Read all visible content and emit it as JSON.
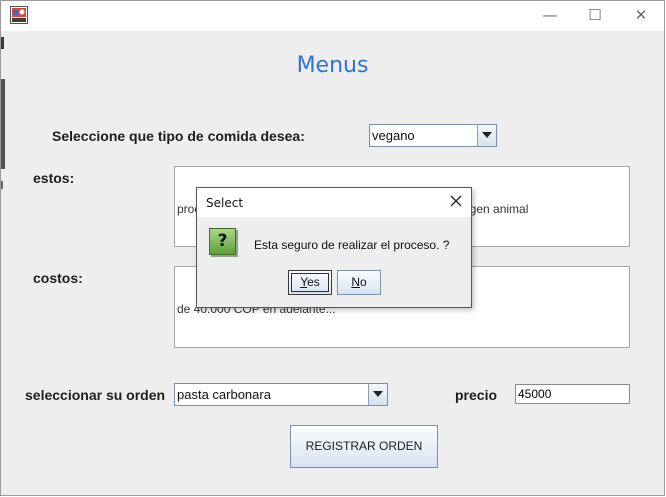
{
  "window": {
    "title": "",
    "controls": {
      "minimize": "—",
      "maximize": "☐",
      "close": "✕"
    }
  },
  "page": {
    "title": "Menus",
    "food_type_label": "Seleccione que tipo de comida desea:",
    "food_type_value": "vegano",
    "details_label": "estos:",
    "details_text_visible": "proc",
    "details_text_right": "igen animal",
    "costs_label": "costos:",
    "costs_text": "de 40.000 COP en adelante...",
    "order_label": "seleccionar su orden",
    "order_value": "pasta carbonara",
    "price_label": "precio",
    "price_value": "45000",
    "register_button": "REGISTRAR ORDEN"
  },
  "dialog": {
    "title": "Select",
    "message": "Esta seguro de realizar el proceso. ?",
    "icon": "question-icon",
    "icon_glyph": "?",
    "yes_label_first": "Y",
    "yes_label_rest": "es",
    "no_label_first": "N",
    "no_label_rest": "o"
  },
  "colors": {
    "title_blue": "#2e74d6",
    "question_green": "#5f9e3a"
  }
}
